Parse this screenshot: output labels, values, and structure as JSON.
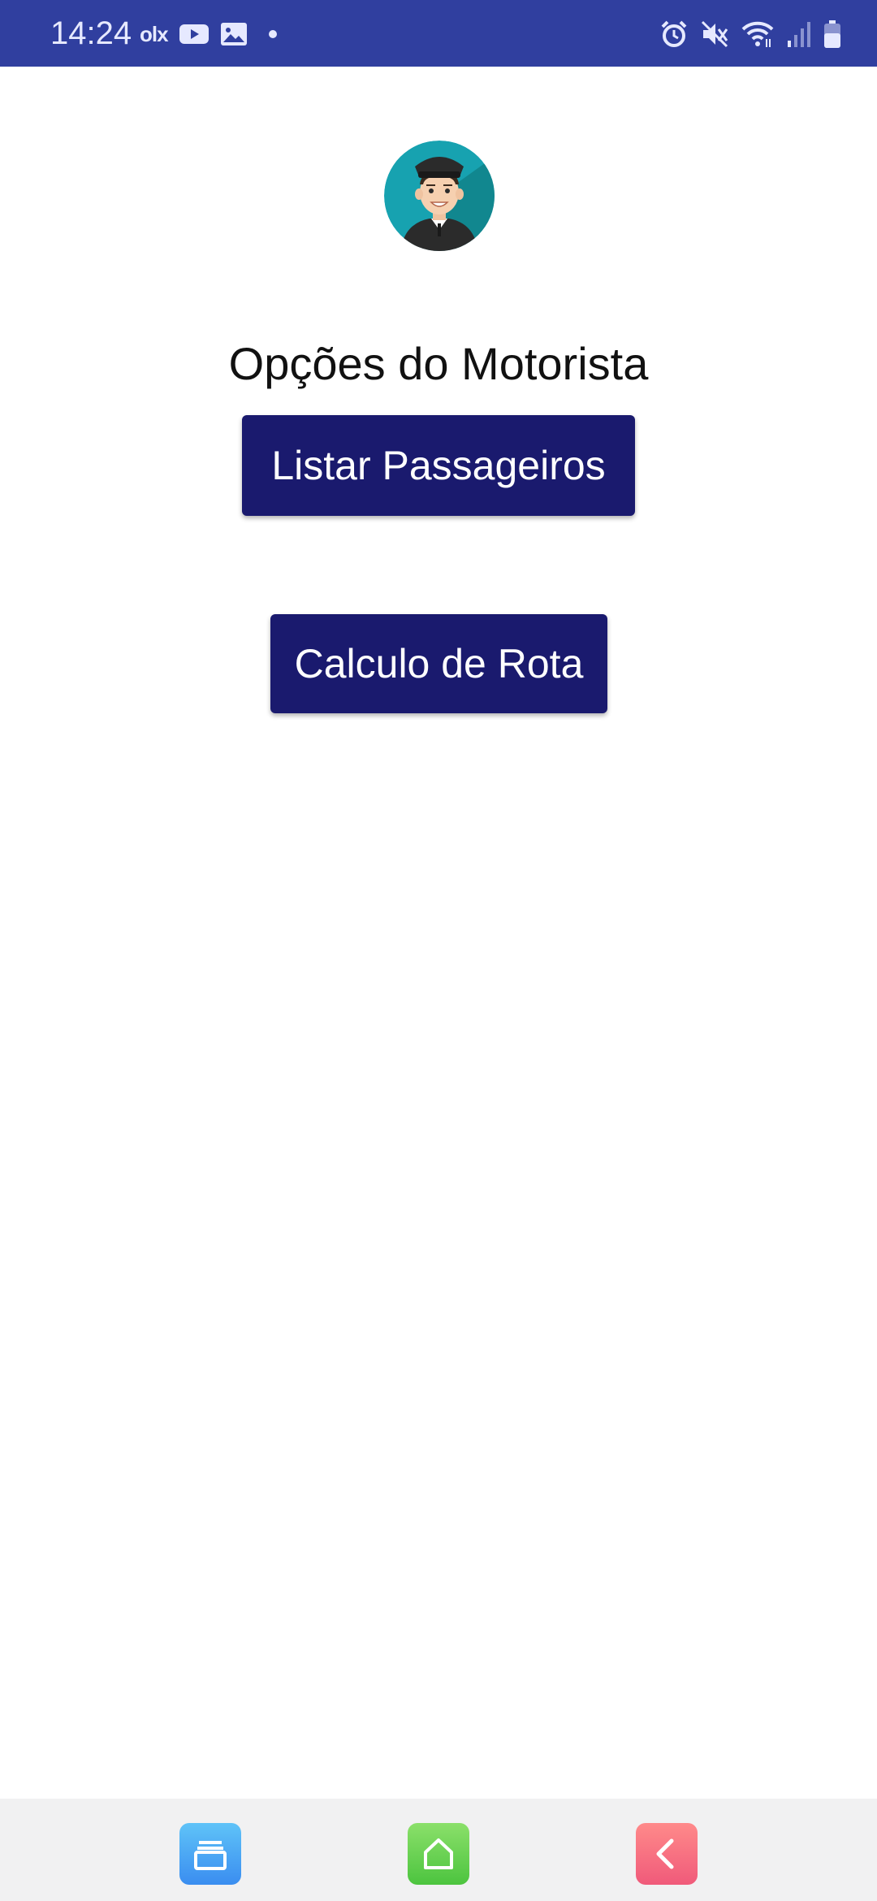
{
  "status_bar": {
    "time": "14:24",
    "notification_icons": [
      "olx-icon",
      "youtube-icon",
      "gallery-icon",
      "dot-icon"
    ],
    "olx_text": "olx",
    "system_icons": [
      "alarm-icon",
      "mute-icon",
      "wifi-icon",
      "signal-icon",
      "battery-icon"
    ],
    "background_color": "#303f9f"
  },
  "main": {
    "avatar": "driver-avatar-icon",
    "title": "Opções do Motorista",
    "buttons": {
      "list_passengers": "Listar Passageiros",
      "route_calc": "Calculo de Rota"
    },
    "button_color": "#1a1a6e"
  },
  "nav_bar": {
    "items": [
      "recent-apps-icon",
      "home-icon",
      "back-icon"
    ]
  }
}
